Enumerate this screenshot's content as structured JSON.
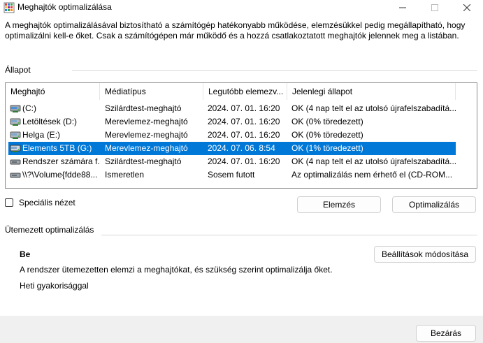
{
  "window": {
    "title": "Meghajtók optimalizálása",
    "icon": "defrag-app-icon"
  },
  "description": "A meghajtók optimalizálásával biztosítható a számítógép hatékonyabb működése, elemzésükkel pedig megállapítható, hogy optimalizálni kell-e őket. Csak a számítógépen már működő és a hozzá csatlakoztatott meghajtók jelennek meg a listában.",
  "status_section": {
    "label": "Állapot"
  },
  "drive_list": {
    "columns": [
      "Meghajtó",
      "Médiatípus",
      "Legutóbb elemezv...",
      "Jelenlegi állapot"
    ],
    "rows": [
      {
        "name": "(C:)",
        "media": "Szilárdtest-meghajtó",
        "last": "2024. 07. 01. 16:20",
        "status": "OK (4 nap telt el az utolsó újrafelszabadítá...",
        "icon": "ssd-drive-icon",
        "selected": false
      },
      {
        "name": "Letöltések (D:)",
        "media": "Merevlemez-meghajtó",
        "last": "2024. 07. 01. 16:20",
        "status": "OK (0% töredezett)",
        "icon": "hdd-drive-icon",
        "selected": false
      },
      {
        "name": "Helga (E:)",
        "media": "Merevlemez-meghajtó",
        "last": "2024. 07. 01. 16:20",
        "status": "OK (0% töredezett)",
        "icon": "hdd-drive-icon",
        "selected": false
      },
      {
        "name": "Elements 5TB (G:)",
        "media": "Merevlemez-meghajtó",
        "last": "2024. 07. 06. 8:54",
        "status": "OK (1% töredezett)",
        "icon": "hdd-drive-icon",
        "selected": true
      },
      {
        "name": "Rendszer számára f...",
        "media": "Szilárdtest-meghajtó",
        "last": "2024. 07. 01. 16:20",
        "status": "OK (4 nap telt el az utolsó újrafelszabadítá...",
        "icon": "system-drive-icon",
        "selected": false
      },
      {
        "name": "\\\\?\\Volume{fdde88...",
        "media": "Ismeretlen",
        "last": "Sosem futott",
        "status": "Az optimalizálás nem érhető el (CD-ROM...",
        "icon": "volume-drive-icon",
        "selected": false
      }
    ]
  },
  "advanced_view": {
    "label": "Speciális nézet",
    "checked": false
  },
  "buttons": {
    "analyze": "Elemzés",
    "optimize": "Optimalizálás",
    "change_settings": "Beállítások módosítása",
    "close": "Bezárás"
  },
  "scheduled": {
    "label": "Ütemezett optimalizálás",
    "state": "Be",
    "description": "A rendszer ütemezetten elemzi a meghajtókat, és szükség szerint optimalizálja őket.",
    "frequency": "Heti gyakorisággal"
  },
  "colors": {
    "selection": "#0078d7",
    "footer": "#f0f0f0",
    "accent_icon": "#3a8fd8"
  }
}
